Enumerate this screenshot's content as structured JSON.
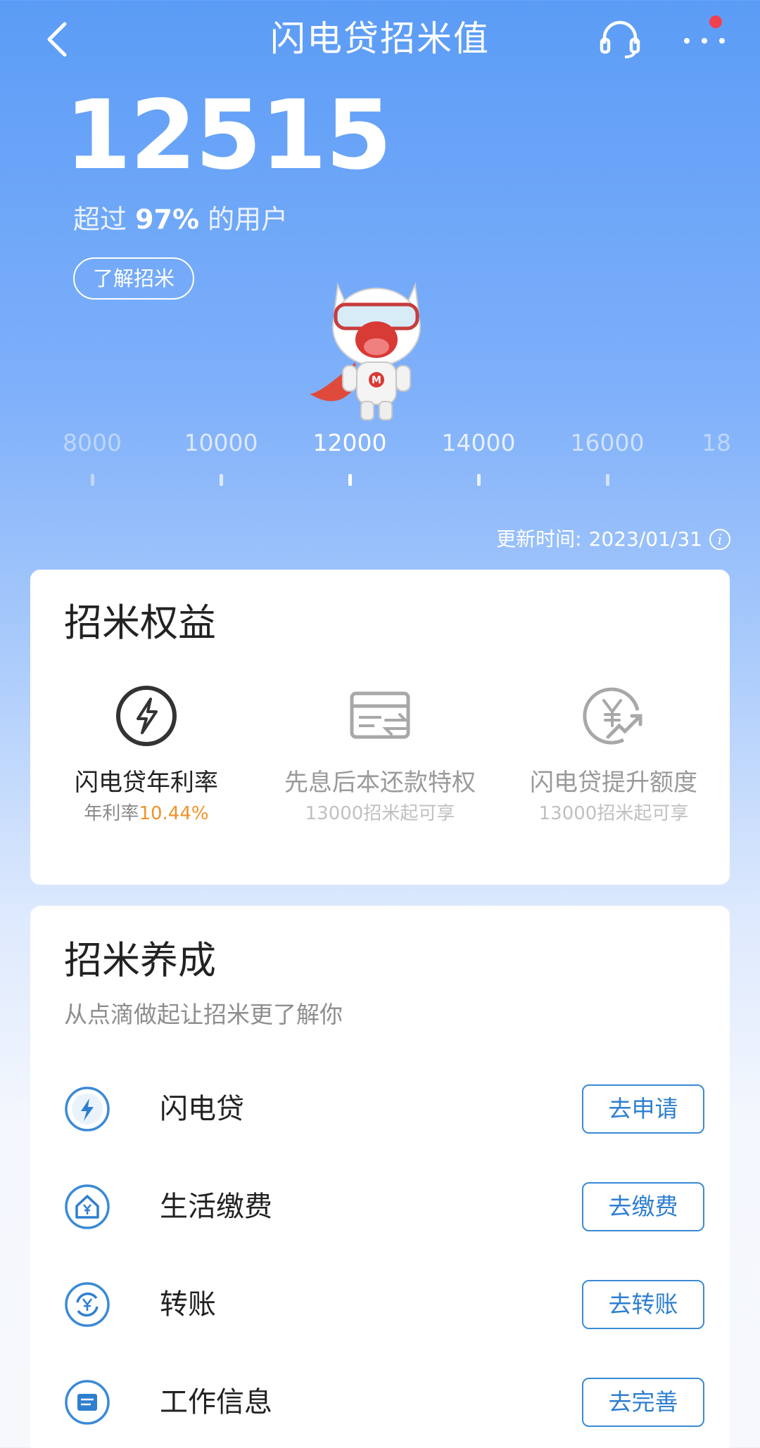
{
  "header": {
    "title": "闪电贷招米值"
  },
  "score": {
    "value": "12515",
    "rank_prefix": "超过",
    "rank_percent": "97%",
    "rank_suffix": "的用户",
    "learn_label": "了解招米"
  },
  "scale": {
    "ticks": [
      "8000",
      "10000",
      "12000",
      "14000",
      "16000",
      "18"
    ],
    "current": "12000",
    "current_value": 12515
  },
  "update": {
    "label": "更新时间:",
    "date": "2023/01/31"
  },
  "benefits": {
    "title": "招米权益",
    "items": [
      {
        "label": "闪电贷年利率",
        "sub_prefix": "年利率",
        "sub_value": "10.44%",
        "icon": "lightning-icon"
      },
      {
        "label": "先息后本还款特权",
        "sub": "13000招米起可享",
        "icon": "card-transfer-icon"
      },
      {
        "label": "闪电贷提升额度",
        "sub": "13000招米起可享",
        "icon": "yuan-growth-icon"
      }
    ]
  },
  "grow": {
    "title": "招米养成",
    "subtitle": "从点滴做起让招米更了解你",
    "items": [
      {
        "label": "闪电贷",
        "button": "去申请",
        "icon": "lightning-circle-icon"
      },
      {
        "label": "生活缴费",
        "button": "去缴费",
        "icon": "house-yuan-icon"
      },
      {
        "label": "转账",
        "button": "去转账",
        "icon": "yuan-exchange-icon"
      },
      {
        "label": "工作信息",
        "button": "去完善",
        "icon": "briefcase-icon"
      }
    ]
  },
  "colors": {
    "accent_blue": "#3a8ad6",
    "highlight_orange": "#f0922a",
    "notification_red": "#f0414e"
  }
}
